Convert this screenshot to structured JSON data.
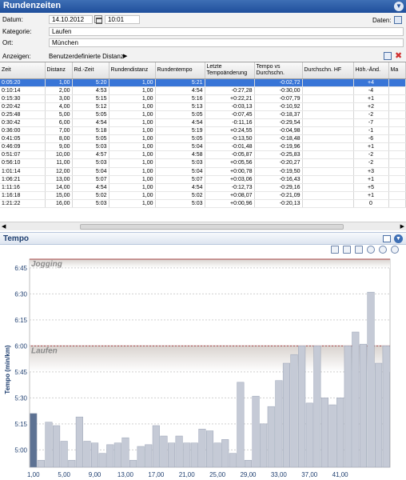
{
  "window_title": "Rundenzeiten",
  "form": {
    "date_label": "Datum:",
    "date_value": "14.10.2012",
    "time_value": "10:01",
    "data_label": "Daten:",
    "category_label": "Kategorie:",
    "category_value": "Laufen",
    "location_label": "Ort:",
    "location_value": "München",
    "show_label": "Anzeigen:",
    "show_value": "Benutzerdefinierte Distanz"
  },
  "table": {
    "columns": [
      "Zeit",
      "Distanz",
      "Rd.-Zeit",
      "Rundendistanz",
      "Rundentempo",
      "Letzte Tempoänderung",
      "Tempo vs Durchschn.",
      "Durchschn. HF",
      "Höh.-Änd.",
      "Ma"
    ],
    "rows": [
      [
        "0:05:20",
        "1,00",
        "5:20",
        "1,00",
        "5:21",
        "",
        "-0:02,72",
        "",
        "+4"
      ],
      [
        "0:10:14",
        "2,00",
        "4:53",
        "1,00",
        "4:54",
        "-0:27,28",
        "-0:30,00",
        "",
        "-4"
      ],
      [
        "0:15:30",
        "3,00",
        "5:15",
        "1,00",
        "5:16",
        "+0:22,21",
        "-0:07,79",
        "",
        "+1"
      ],
      [
        "0:20:42",
        "4,00",
        "5:12",
        "1,00",
        "5:13",
        "-0:03,13",
        "-0:10,92",
        "",
        "+2"
      ],
      [
        "0:25:48",
        "5,00",
        "5:05",
        "1,00",
        "5:05",
        "-0:07,45",
        "-0:18,37",
        "",
        "-2"
      ],
      [
        "0:30:42",
        "6,00",
        "4:54",
        "1,00",
        "4:54",
        "-0:11,16",
        "-0:29,54",
        "",
        "-7"
      ],
      [
        "0:36:00",
        "7,00",
        "5:18",
        "1,00",
        "5:19",
        "+0:24,55",
        "-0:04,98",
        "",
        "-1"
      ],
      [
        "0:41:05",
        "8,00",
        "5:05",
        "1,00",
        "5:05",
        "-0:13,50",
        "-0:18,48",
        "",
        "-6"
      ],
      [
        "0:46:09",
        "9,00",
        "5:03",
        "1,00",
        "5:04",
        "-0:01,48",
        "-0:19,96",
        "",
        "+1"
      ],
      [
        "0:51:07",
        "10,00",
        "4:57",
        "1,00",
        "4:58",
        "-0:05,87",
        "-0:25,83",
        "",
        "-2"
      ],
      [
        "0:56:10",
        "11,00",
        "5:03",
        "1,00",
        "5:03",
        "+0:05,56",
        "-0:20,27",
        "",
        "-2"
      ],
      [
        "1:01:14",
        "12,00",
        "5:04",
        "1,00",
        "5:04",
        "+0:00,78",
        "-0:19,50",
        "",
        "+3"
      ],
      [
        "1:06:21",
        "13,00",
        "5:07",
        "1,00",
        "5:07",
        "+0:03,06",
        "-0:16,43",
        "",
        "+1"
      ],
      [
        "1:11:16",
        "14,00",
        "4:54",
        "1,00",
        "4:54",
        "-0:12,73",
        "-0:29,16",
        "",
        "+5"
      ],
      [
        "1:16:18",
        "15,00",
        "5:02",
        "1,00",
        "5:02",
        "+0:08,07",
        "-0:21,09",
        "",
        "+1"
      ],
      [
        "1:21:22",
        "16,00",
        "5:03",
        "1,00",
        "5:03",
        "+0:00,96",
        "-0:20,13",
        "",
        "0"
      ]
    ]
  },
  "chart_section_title": "Tempo",
  "colors": {
    "title_bar": "#1f4f9c",
    "selected_row": "#3875d7",
    "bar_fill": "#c5cad6",
    "bar_selected": "#5d7293",
    "zone_band": "#e9e5e2",
    "zone_line": "#a04040"
  },
  "chart_data": {
    "type": "bar",
    "xlabel": "",
    "ylabel": "Tempo (min/km)",
    "x_ticks": [
      "1,00",
      "5,00",
      "9,00",
      "13,00",
      "17,00",
      "21,00",
      "25,00",
      "29,00",
      "33,00",
      "37,00",
      "41,00"
    ],
    "y_ticks": [
      "5:00",
      "5:15",
      "5:30",
      "5:45",
      "6:00",
      "6:15",
      "6:30",
      "6:45"
    ],
    "ylim_seconds": [
      290,
      410
    ],
    "zones": [
      {
        "name": "Jogging",
        "from_seconds": 405,
        "to_seconds": 410
      },
      {
        "name": "Laufen",
        "from_seconds": 345,
        "to_seconds": 360
      }
    ],
    "selected_index": 0,
    "x": [
      1,
      2,
      3,
      4,
      5,
      6,
      7,
      8,
      9,
      10,
      11,
      12,
      13,
      14,
      15,
      16,
      17,
      18,
      19,
      20,
      21,
      22,
      23,
      24,
      25,
      26,
      27,
      28,
      29,
      30,
      31,
      32,
      33,
      34,
      35,
      36,
      37,
      38,
      39,
      40,
      41,
      42,
      43,
      44
    ],
    "values": [
      321,
      294,
      316,
      314,
      305,
      294,
      319,
      305,
      304,
      298,
      303,
      304,
      307,
      294,
      302,
      303,
      314,
      308,
      304,
      308,
      304,
      304,
      312,
      311,
      304,
      306,
      298,
      339,
      294,
      331,
      315,
      325,
      340,
      350,
      355,
      360,
      327,
      360,
      330,
      326,
      330,
      360,
      368,
      361,
      391,
      350,
      360
    ]
  }
}
